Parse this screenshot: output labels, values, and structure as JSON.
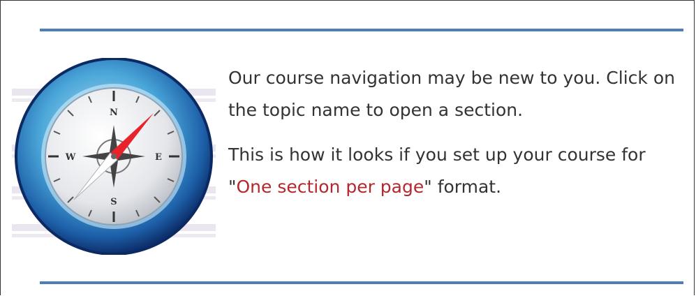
{
  "intro": {
    "paragraph1": "Our course navigation may be new to you. Click on the topic name to open a section.",
    "paragraph2_before": "This is how it looks if you set up your course for \"",
    "paragraph2_highlight": "One section per page",
    "paragraph2_after": "\" format."
  },
  "compass": {
    "north": "N",
    "south": "S",
    "east": "E",
    "west": "W",
    "icon": "compass-icon"
  },
  "colors": {
    "rule": "#4f7db8",
    "highlight": "#b3282d",
    "text": "#333333"
  }
}
